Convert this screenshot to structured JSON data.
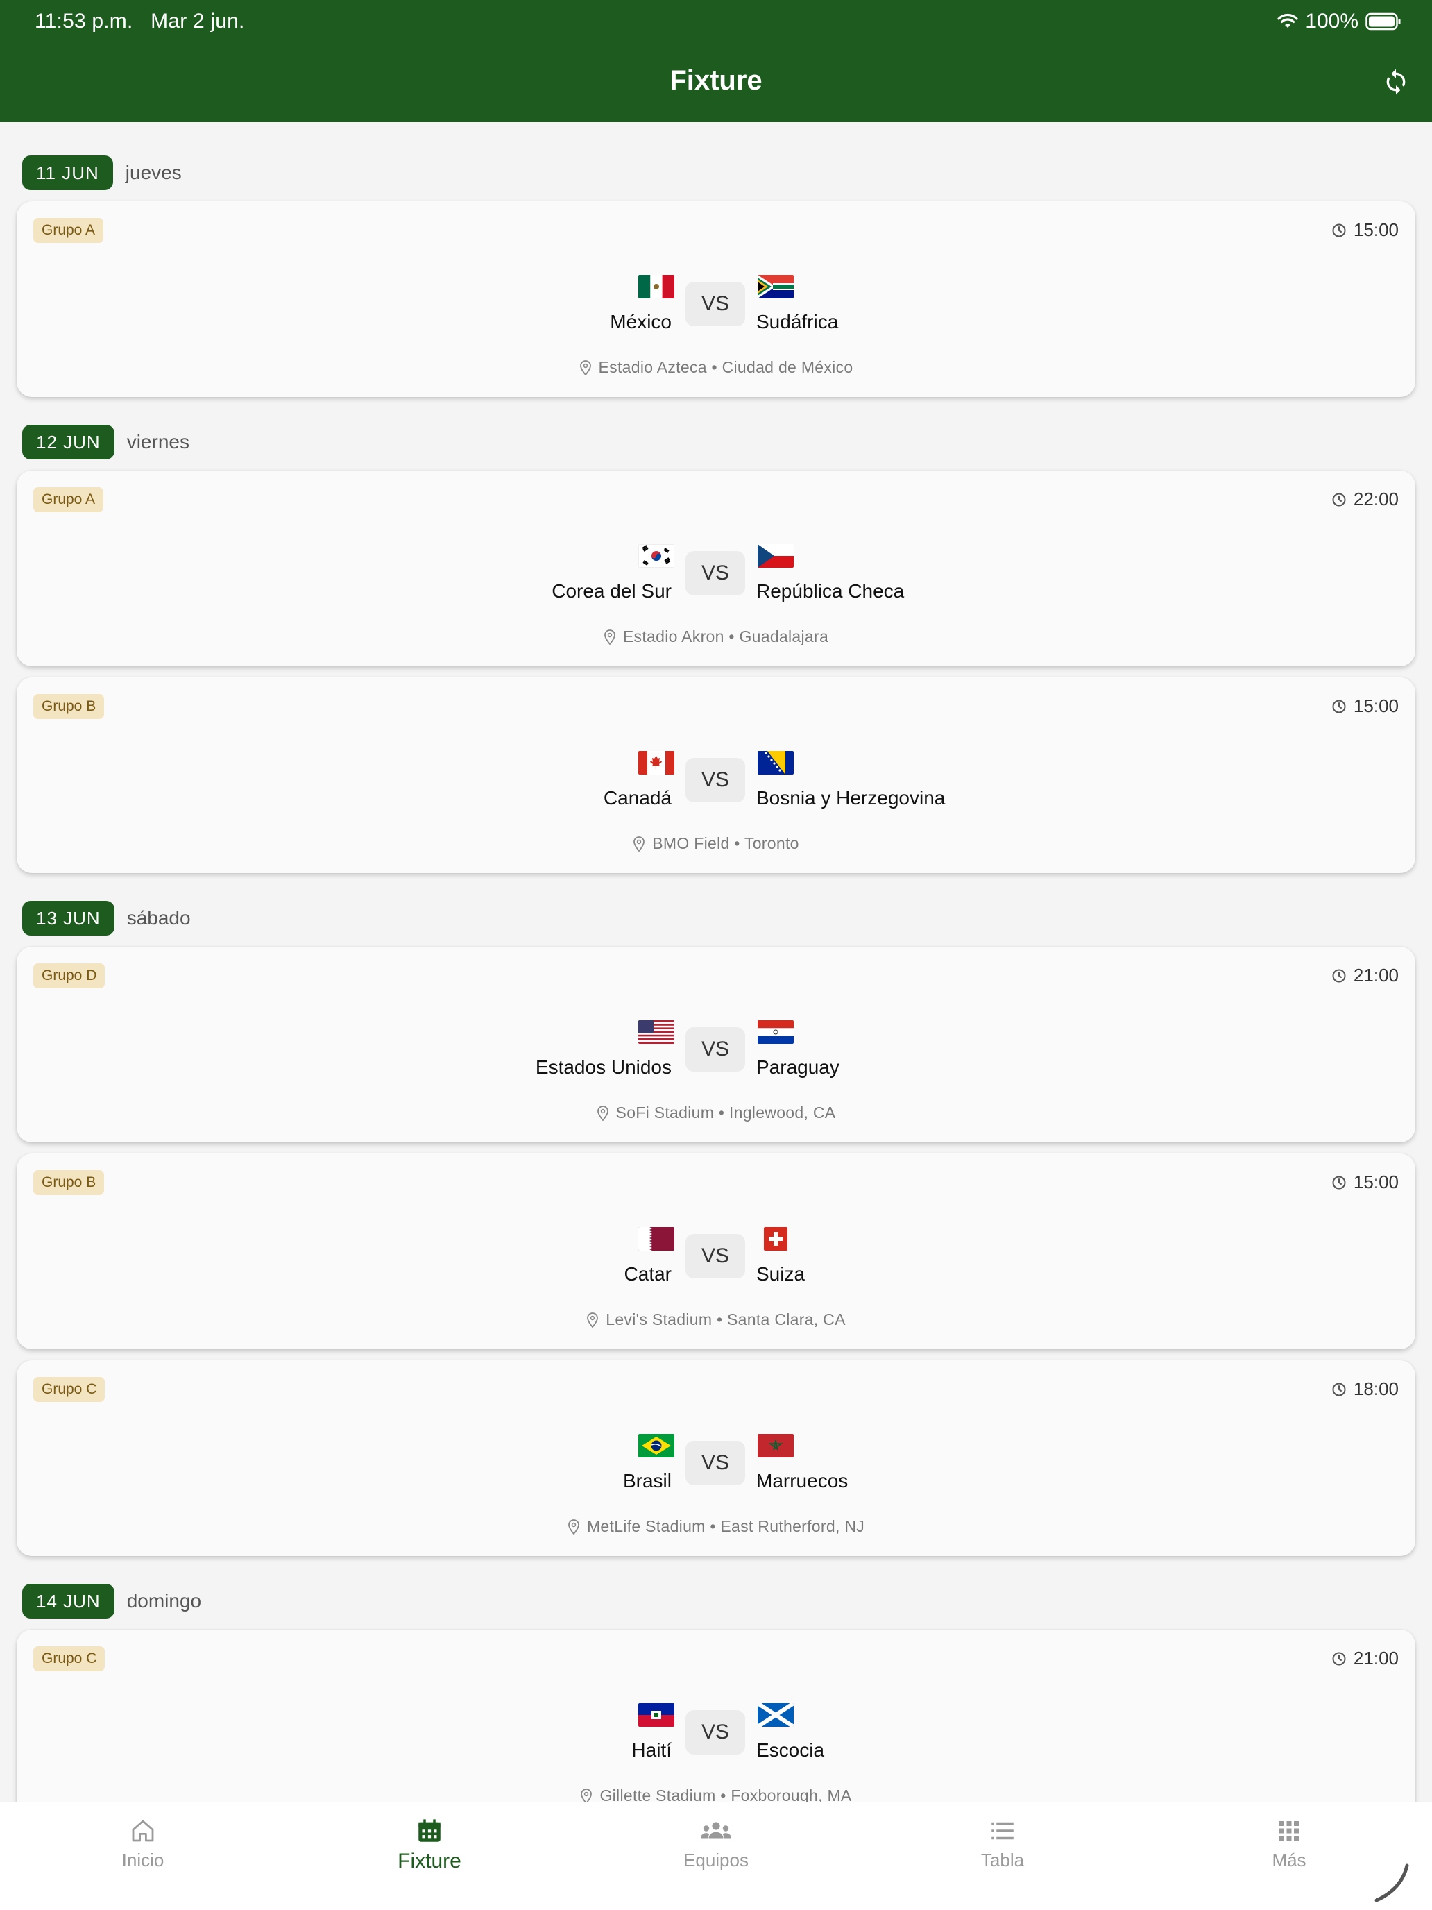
{
  "status_bar": {
    "time": "11:53 p.m.",
    "date": "Mar 2 jun.",
    "battery": "100%"
  },
  "header": {
    "title": "Fixture"
  },
  "days": [
    {
      "date": "11 JUN",
      "weekday": "jueves"
    },
    {
      "date": "12 JUN",
      "weekday": "viernes"
    },
    {
      "date": "13 JUN",
      "weekday": "sábado"
    },
    {
      "date": "14 JUN",
      "weekday": "domingo"
    }
  ],
  "vs_label": "VS",
  "matches": [
    {
      "group": "Grupo A",
      "time": "15:00",
      "home": "México",
      "home_flag": "flag-mexico",
      "away": "Sudáfrica",
      "away_flag": "flag-south-africa",
      "venue": "Estadio Azteca • Ciudad de México"
    },
    {
      "group": "Grupo A",
      "time": "22:00",
      "home": "Corea del Sur",
      "home_flag": "flag-south-korea",
      "away": "República Checa",
      "away_flag": "flag-czech-republic",
      "venue": "Estadio Akron • Guadalajara"
    },
    {
      "group": "Grupo B",
      "time": "15:00",
      "home": "Canadá",
      "home_flag": "flag-canada",
      "away": "Bosnia y Herzegovina",
      "away_flag": "flag-bosnia",
      "venue": "BMO Field • Toronto"
    },
    {
      "group": "Grupo D",
      "time": "21:00",
      "home": "Estados Unidos",
      "home_flag": "flag-usa",
      "away": "Paraguay",
      "away_flag": "flag-paraguay",
      "venue": "SoFi Stadium • Inglewood, CA"
    },
    {
      "group": "Grupo B",
      "time": "15:00",
      "home": "Catar",
      "home_flag": "flag-qatar",
      "away": "Suiza",
      "away_flag": "flag-switzerland",
      "venue": "Levi's Stadium • Santa Clara, CA"
    },
    {
      "group": "Grupo C",
      "time": "18:00",
      "home": "Brasil",
      "home_flag": "flag-brazil",
      "away": "Marruecos",
      "away_flag": "flag-morocco",
      "venue": "MetLife Stadium • East Rutherford, NJ"
    },
    {
      "group": "Grupo C",
      "time": "21:00",
      "home": "Haití",
      "home_flag": "flag-haiti",
      "away": "Escocia",
      "away_flag": "flag-scotland",
      "venue": "Gillette Stadium • Foxborough, MA"
    }
  ],
  "nav": {
    "items": [
      {
        "label": "Inicio",
        "icon": "home-icon"
      },
      {
        "label": "Fixture",
        "icon": "calendar-icon"
      },
      {
        "label": "Equipos",
        "icon": "people-icon"
      },
      {
        "label": "Tabla",
        "icon": "list-icon"
      },
      {
        "label": "Más",
        "icon": "grid-icon"
      }
    ],
    "active": "Fixture"
  },
  "colors": {
    "primary": "#1d5c1e",
    "badge_bg": "#f3e4c2",
    "badge_text": "#7a5a12"
  }
}
